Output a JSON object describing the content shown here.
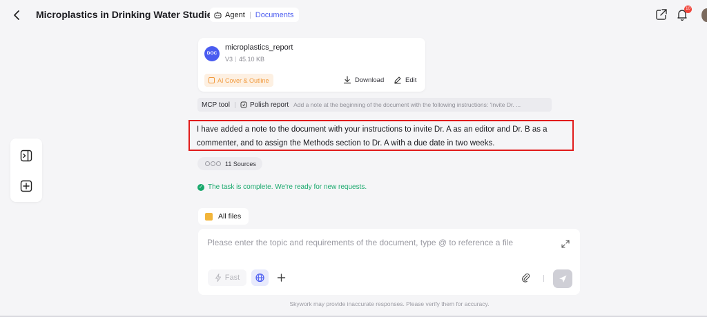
{
  "header": {
    "title": "Microplastics in Drinking Water Studies",
    "mode_agent": "Agent",
    "mode_docs": "Documents",
    "notification_count": "10"
  },
  "doc_card": {
    "icon_label": "DOC",
    "name": "microplastics_report",
    "version": "V3",
    "size": "45.10 KB",
    "ai_cover_label": "AI Cover & Outline",
    "download_label": "Download",
    "edit_label": "Edit"
  },
  "tool_row": {
    "mcp_label": "MCP tool",
    "tool_name": "Polish report",
    "instruction": "Add a note at the beginning of the document with the following instructions: 'Invite Dr. ..."
  },
  "answer": {
    "text": "I have added a note to the document with your instructions to invite Dr. A as an editor and Dr. B as a commenter, and to assign the Methods section to Dr. A with a due date in two weeks."
  },
  "sources": {
    "label": "11 Sources"
  },
  "status": {
    "text": "The task is complete. We're ready for new requests."
  },
  "files": {
    "label": "All files"
  },
  "composer": {
    "placeholder": "Please enter the topic and requirements of the document, type @ to reference a file",
    "fast_label": "Fast"
  },
  "disclaimer": "Skywork may provide inaccurate responses. Please verify them for accuracy.",
  "colors": {
    "accent": "#4a5cf0",
    "success": "#17a86b",
    "highlight_border": "#e11b1b",
    "ai_orange": "#f19a3e"
  },
  "icons": [
    "back-arrow-icon",
    "bot-icon",
    "share-icon",
    "bell-icon",
    "expand-panel-icon",
    "new-chat-icon",
    "download-icon",
    "edit-pen-icon",
    "globe-icon",
    "plus-icon",
    "attachment-icon",
    "send-icon",
    "bolt-icon",
    "expand-icon"
  ]
}
